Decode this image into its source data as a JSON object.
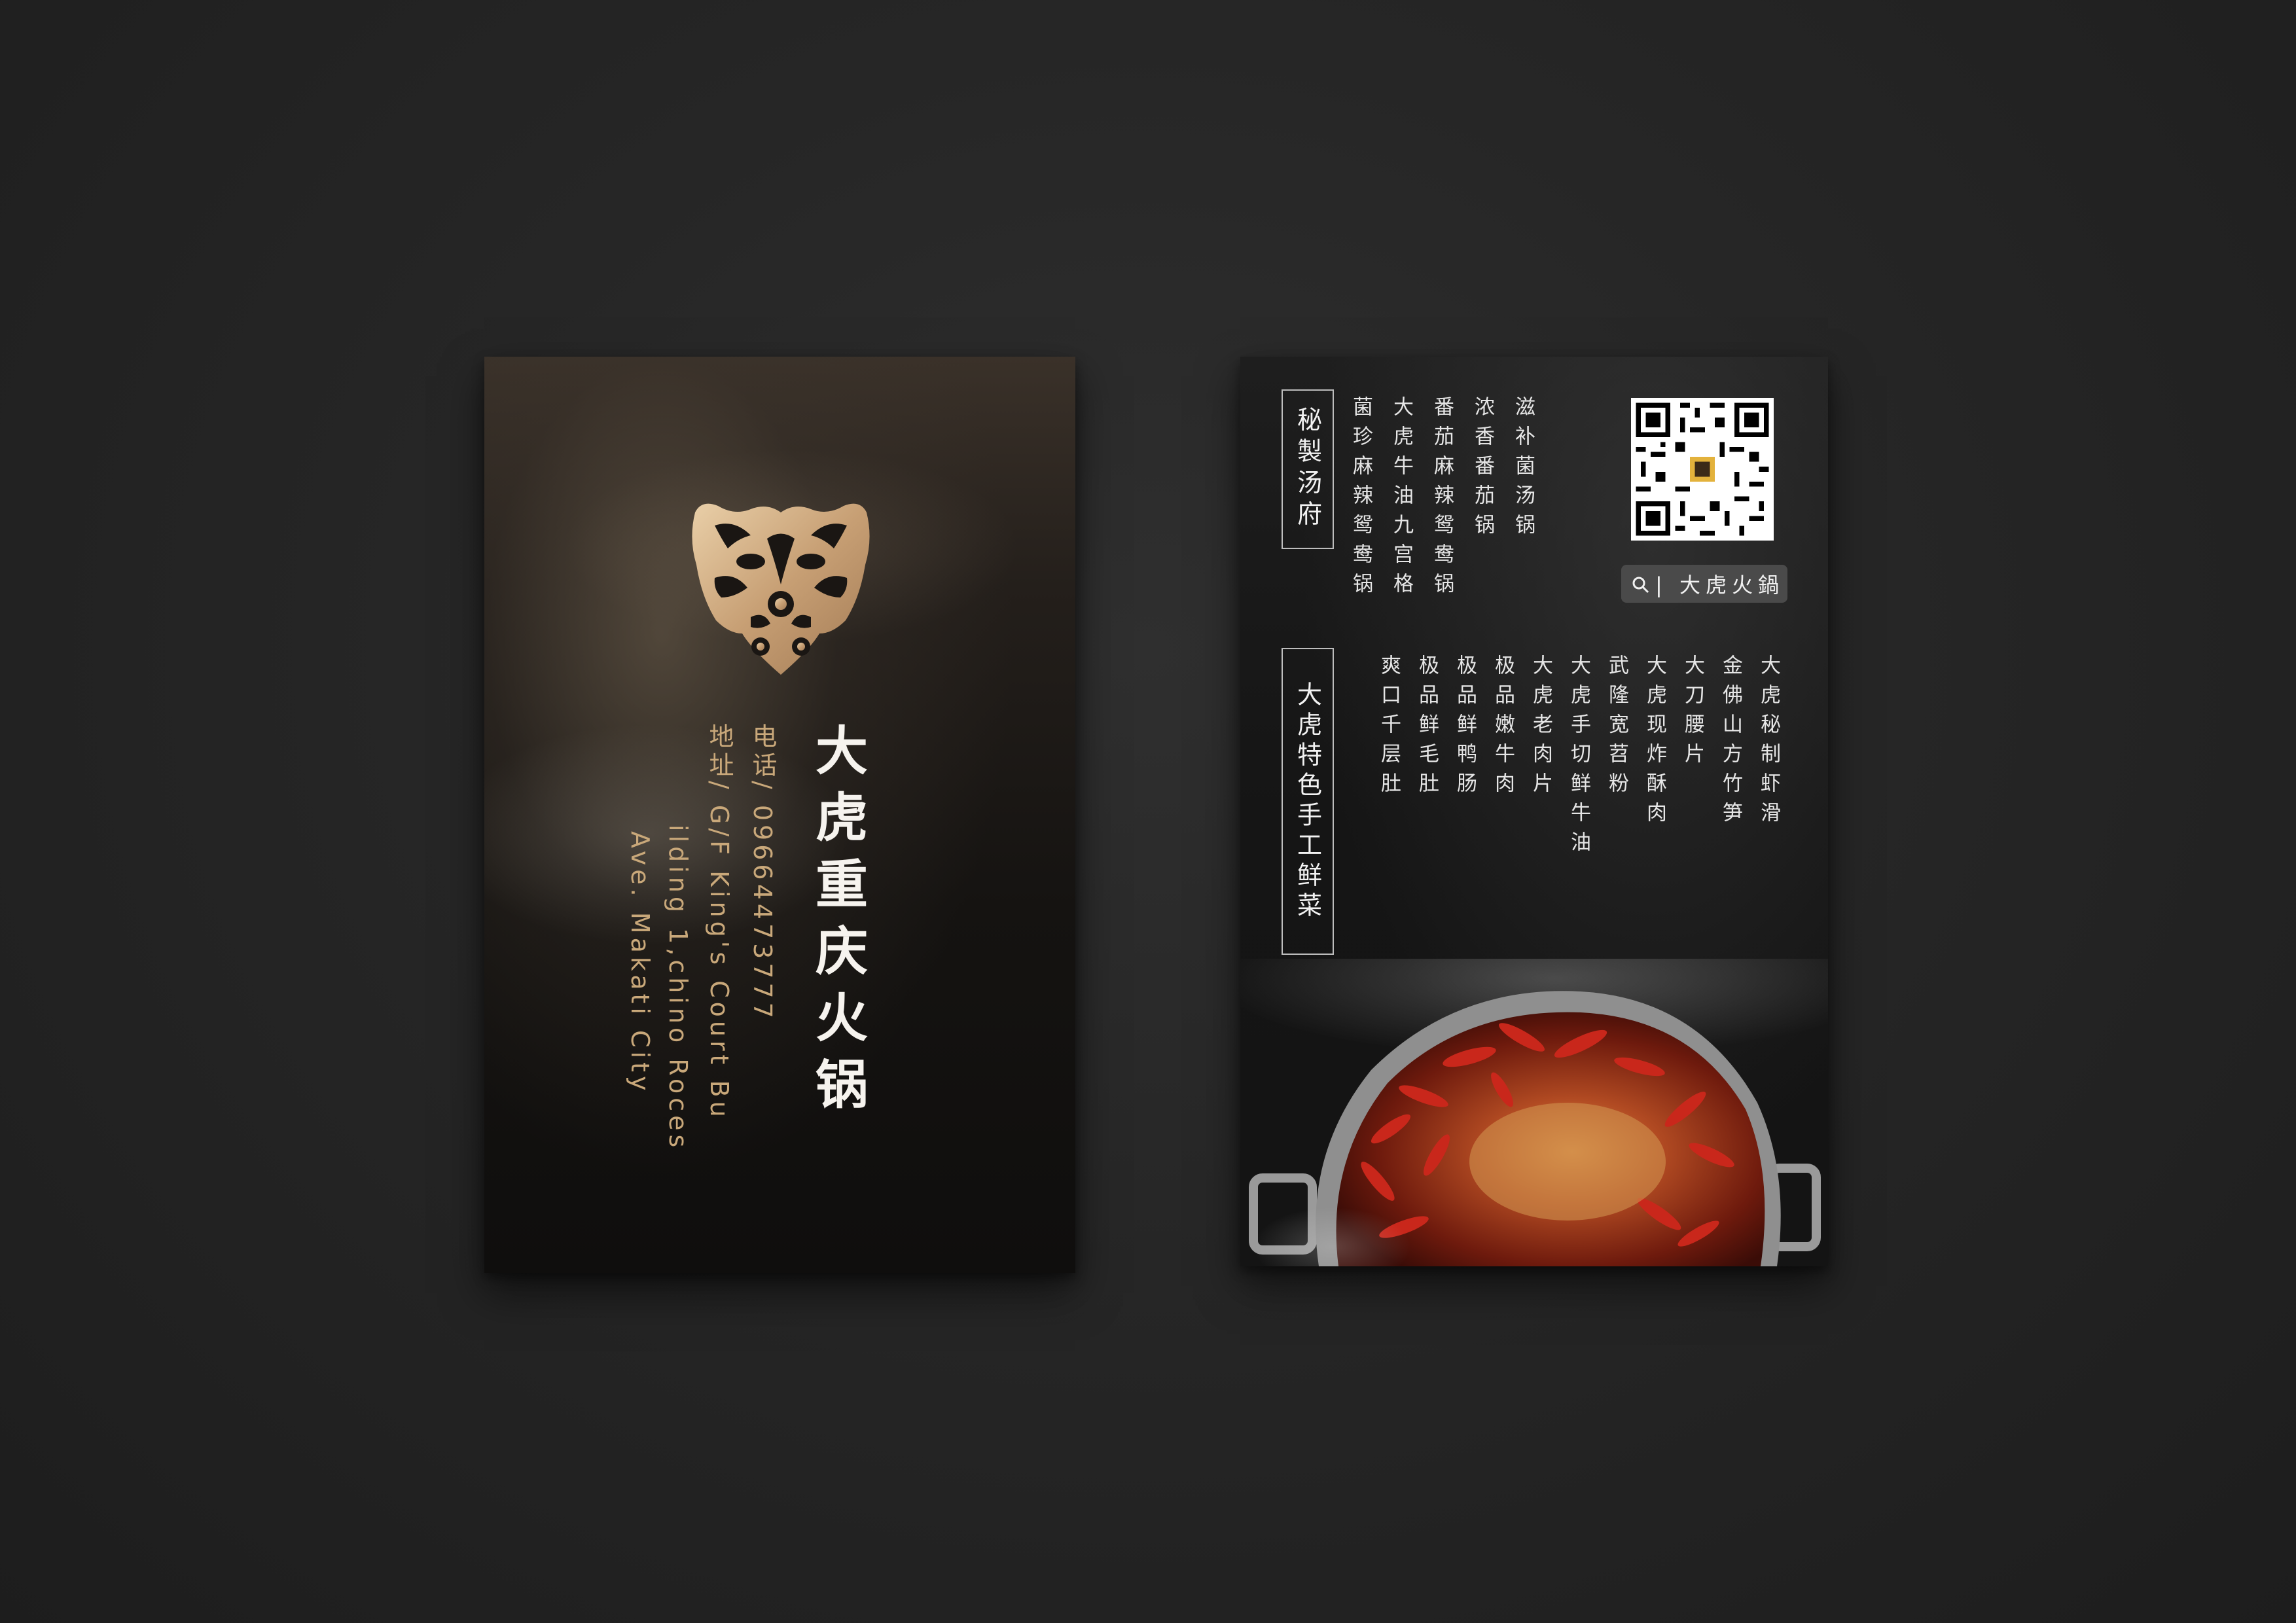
{
  "front": {
    "brand_name": "大虎重庆火锅",
    "phone_label": "电话",
    "phone_number": "/ 09664473777",
    "address_label": "地址",
    "address_line1": "/ G/F King's Court Bu",
    "address_line2": "ilding 1,chino Roces",
    "address_line3": "Ave. Makati City",
    "logo_icon": "tiger-face-emblem"
  },
  "back": {
    "soup_section_title": "秘製汤府",
    "soup_items": [
      "滋补菌汤锅",
      "浓香番茄锅",
      "番茄麻辣鸳鸯锅",
      "大虎牛油九宫格",
      "菌珍麻辣鸳鸯锅"
    ],
    "qr_icon": "qr-code",
    "search_icon": "search-icon",
    "search_label": "| 大虎火鍋",
    "special_section_title": "大虎特色手工鲜菜",
    "special_items": [
      "大虎秘制虾滑",
      "金佛山方竹笋",
      "大刀腰片",
      "大虎现炸酥肉",
      "武隆宽苕粉",
      "大虎手切鲜牛油",
      "大虎老肉片",
      "极品嫩牛肉",
      "极品鲜鸭肠",
      "极品鲜毛肚",
      "爽口千层肚"
    ],
    "photo": "hotpot-with-red-chilies"
  },
  "colors": {
    "background": "#262626",
    "gold": "#c9a87a",
    "white_text": "#f6f3ee"
  }
}
